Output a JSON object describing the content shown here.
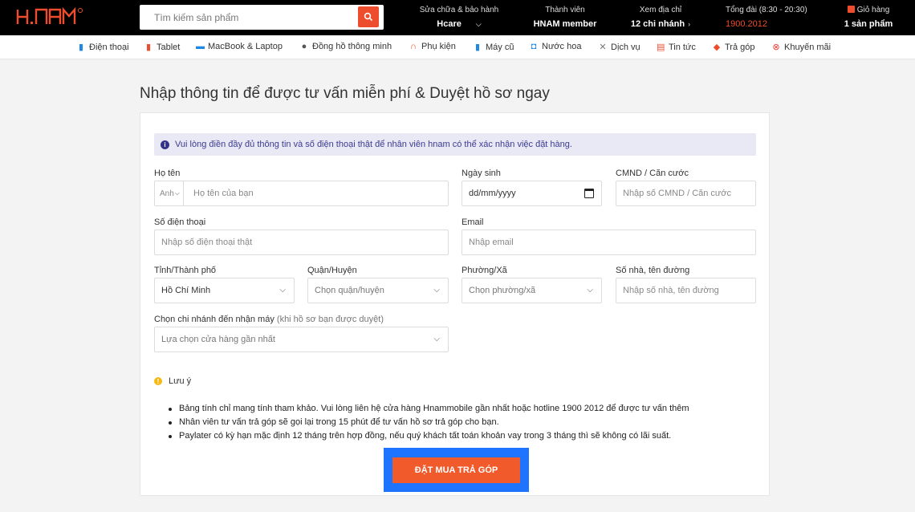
{
  "header": {
    "logo_text": "H.NAM",
    "search_placeholder": "Tìm kiếm sản phẩm",
    "repair": {
      "label": "Sửa chữa & bảo hành",
      "value": "Hcare"
    },
    "member": {
      "label": "Thành viên",
      "value": "HNAM member"
    },
    "address": {
      "label": "Xem địa chỉ",
      "value": "12 chi nhánh"
    },
    "hotline": {
      "label": "Tổng đài (8:30 - 20:30)",
      "value": "1900.2012"
    },
    "cart": {
      "label": "Giỏ hàng",
      "value": "1 sản phẩm"
    },
    "brand_color": "#ee4d2d"
  },
  "nav": {
    "items": [
      {
        "label": "Điện thoại",
        "icon": "phone-icon"
      },
      {
        "label": "Tablet",
        "icon": "tablet-icon"
      },
      {
        "label": "MacBook & Laptop",
        "icon": "laptop-icon"
      },
      {
        "label": "Đồng hồ thông minh",
        "icon": "watch-icon"
      },
      {
        "label": "Phụ kiện",
        "icon": "headphone-icon"
      },
      {
        "label": "Máy cũ",
        "icon": "used-phone-icon"
      },
      {
        "label": "Nước hoa",
        "icon": "perfume-icon"
      },
      {
        "label": "Dịch vụ",
        "icon": "tools-icon"
      },
      {
        "label": "Tin tức",
        "icon": "news-icon"
      },
      {
        "label": "Trả góp",
        "icon": "installment-icon"
      },
      {
        "label": "Khuyến mãi",
        "icon": "promo-icon"
      }
    ]
  },
  "form": {
    "title": "Nhập thông tin để được tư vấn miễn phí & Duyệt hồ sơ ngay",
    "notice": "Vui lòng điền đầy đủ thông tin và số điện thoại thật để nhân viên hnam có thể xác nhận việc đặt hàng.",
    "name": {
      "label": "Họ tên",
      "placeholder": "Họ tên của bạn",
      "salutation": "Anh"
    },
    "dob": {
      "label": "Ngày sinh",
      "placeholder": "dd/mm/yyyy"
    },
    "id_card": {
      "label": "CMND / Căn cước",
      "placeholder": "Nhập số CMND / Căn cước"
    },
    "phone": {
      "label": "Số điện thoại",
      "placeholder": "Nhập số điện thoại thật"
    },
    "email": {
      "label": "Email",
      "placeholder": "Nhập email"
    },
    "city": {
      "label": "Tỉnh/Thành phố",
      "value": "Hồ Chí Minh"
    },
    "district": {
      "label": "Quận/Huyện",
      "placeholder": "Chọn quận/huyện"
    },
    "ward": {
      "label": "Phường/Xã",
      "placeholder": "Chọn phường/xã"
    },
    "street": {
      "label": "Số nhà, tên đường",
      "placeholder": "Nhập số nhà, tên đường"
    },
    "branch": {
      "label": "Chọn chi nhánh đến nhận máy",
      "label_hint": "(khi hồ sơ bạn được duyệt)",
      "placeholder": "Lựa chọn cửa hàng gần nhất"
    },
    "note_title": "Lưu ý",
    "notes": [
      "Bảng tính chỉ mang tính tham khảo. Vui lòng liên hệ cửa hàng Hnammobile gần nhất hoặc hotline 1900 2012 để được tư vấn thêm",
      "Nhân viên tư vấn trả góp sẽ gọi lại trong 15 phút để tư vấn hồ sơ trả góp cho bạn.",
      "Paylater có kỳ hạn mặc định 12 tháng trên hợp đồng, nếu quý khách tất toán khoản vay trong 3 tháng thì sẽ không có lãi suất."
    ],
    "submit_label": "ĐẶT MUA TRẢ GÓP"
  }
}
